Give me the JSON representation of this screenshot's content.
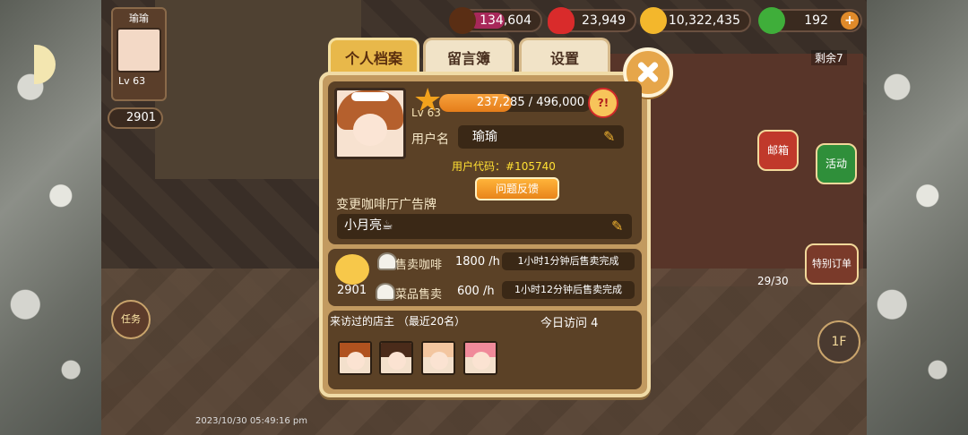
{
  "hud": {
    "coffee_beans": "134,604",
    "hearts": "23,949",
    "gold": "10,322,435",
    "gems": "192",
    "gem_plus": "+"
  },
  "left_panel": {
    "player_name": "瑜瑜",
    "player_level": "Lv 63",
    "reputation": "2901",
    "quest_btn": "任务"
  },
  "right_panel": {
    "remaining": "剩余7",
    "mail_btn": "邮箱",
    "event_btn": "活动",
    "special_order_btn": "特别订单",
    "order_count": "29/30",
    "floor_btn": "1F"
  },
  "timestamp": "2023/10/30 05:49:16 pm",
  "tabs": [
    {
      "label": "个人档案",
      "active": true
    },
    {
      "label": "留言簿",
      "active": false
    },
    {
      "label": "设置",
      "active": false
    }
  ],
  "profile": {
    "level": "Lv 63",
    "exp_text": "237,285 / 496,000",
    "exp_fraction": 0.478,
    "exp_icon": "?!",
    "username_label": "用户名",
    "username": "瑜瑜",
    "user_code": "用户代码：#105740",
    "feedback_btn": "问题反馈",
    "signboard_label": "变更咖啡厅广告牌",
    "signboard_text": "小月亮☕"
  },
  "sales": {
    "reputation": "2901",
    "rows": [
      {
        "label": "售卖咖啡",
        "rate": "1800 /h",
        "status": "1小时1分钟后售卖完成"
      },
      {
        "label": "菜品售卖",
        "rate": "600 /h",
        "status": "1小时12分钟后售卖完成"
      }
    ]
  },
  "visitors": {
    "title": "来访过的店主  （最近20名）",
    "today_label": "今日访问 4",
    "avatars": [
      {
        "hair": "#b0521f"
      },
      {
        "hair": "#4a2b1a"
      },
      {
        "hair": "#f3c6a0"
      },
      {
        "hair": "#f08a9a"
      }
    ]
  },
  "colors": {
    "accent": "#e8b84a",
    "dialog_bg": "#c29a60",
    "panel_bg": "#5b4126",
    "user_code": "#ffe033"
  }
}
